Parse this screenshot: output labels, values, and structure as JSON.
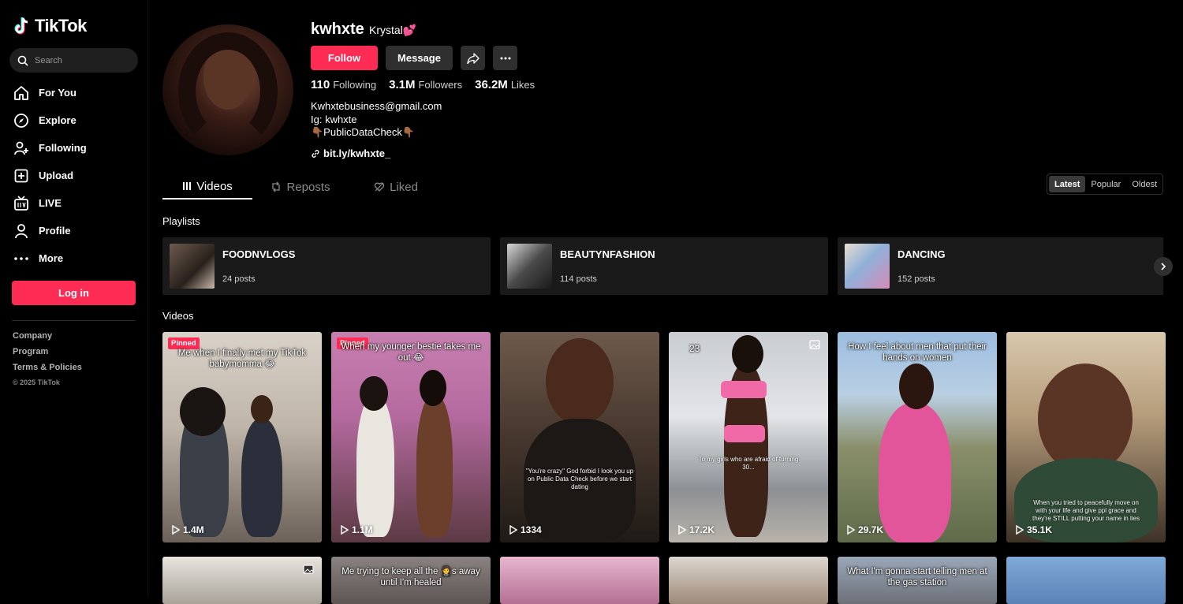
{
  "app": {
    "name": "TikTok"
  },
  "search": {
    "placeholder": "Search"
  },
  "nav": [
    {
      "label": "For You",
      "icon": "home-icon"
    },
    {
      "label": "Explore",
      "icon": "compass-icon"
    },
    {
      "label": "Following",
      "icon": "following-icon"
    },
    {
      "label": "Upload",
      "icon": "upload-icon"
    },
    {
      "label": "LIVE",
      "icon": "live-icon"
    },
    {
      "label": "Profile",
      "icon": "profile-icon"
    },
    {
      "label": "More",
      "icon": "more-icon"
    }
  ],
  "login_label": "Log in",
  "footer": {
    "company": "Company",
    "program": "Program",
    "terms": "Terms & Policies",
    "copyright": "© 2025 TikTok"
  },
  "profile": {
    "username": "kwhxte",
    "nickname": "Krystal💕",
    "follow_label": "Follow",
    "message_label": "Message",
    "following_count": "110",
    "following_label": "Following",
    "followers_count": "3.1M",
    "followers_label": "Followers",
    "likes_count": "36.2M",
    "likes_label": "Likes",
    "bio": [
      "Kwhxtebusiness@gmail.com",
      "Ig: kwhxte",
      "👇🏾PublicDataCheck👇🏾"
    ],
    "link": "bit.ly/kwhxte_"
  },
  "tabs": [
    {
      "label": "Videos",
      "icon": "grid-icon"
    },
    {
      "label": "Reposts",
      "icon": "repost-icon"
    },
    {
      "label": "Liked",
      "icon": "liked-icon"
    }
  ],
  "sort": [
    "Latest",
    "Popular",
    "Oldest"
  ],
  "playlists_title": "Playlists",
  "playlists": [
    {
      "name": "FOODNVLOGS",
      "count": "24 posts"
    },
    {
      "name": "BEAUTYNFASHION",
      "count": "114 posts"
    },
    {
      "name": "DANCING",
      "count": "152 posts"
    }
  ],
  "videos_title": "Videos",
  "videos": [
    {
      "caption": "Me when I finally met my TikTok babymomma 😂",
      "views": "1.4M",
      "pinned": "Pinned",
      "overlay": ""
    },
    {
      "caption": "When my younger bestie takes me out 😂",
      "views": "1.1M",
      "pinned": "Pinned",
      "overlay": ""
    },
    {
      "caption": "",
      "views": "1334",
      "pinned": "",
      "overlay": "\"You're crazy\" God forbid I look you up on Public Data Check before we start dating"
    },
    {
      "caption": "23",
      "views": "17.2K",
      "pinned": "",
      "overlay": "To my girls who are afraid of turning 30..."
    },
    {
      "caption": "How I feel about men that put their hands on women",
      "views": "29.7K",
      "pinned": "",
      "overlay": ""
    },
    {
      "caption": "",
      "views": "35.1K",
      "pinned": "",
      "overlay": "When you tried to peacefully move on with your life and give ppl grace and they're STILL putting your name in lies"
    }
  ],
  "videos_row2": [
    {
      "caption": ""
    },
    {
      "caption": "Me trying to keep all the 🤵s away until I'm healed"
    },
    {
      "caption": ""
    },
    {
      "caption": ""
    },
    {
      "caption": "What I'm gonna start telling men at the gas station"
    },
    {
      "caption": ""
    }
  ],
  "colors": {
    "accent": "#fe2c55",
    "background": "#000000",
    "surface": "#1a1a1a"
  }
}
